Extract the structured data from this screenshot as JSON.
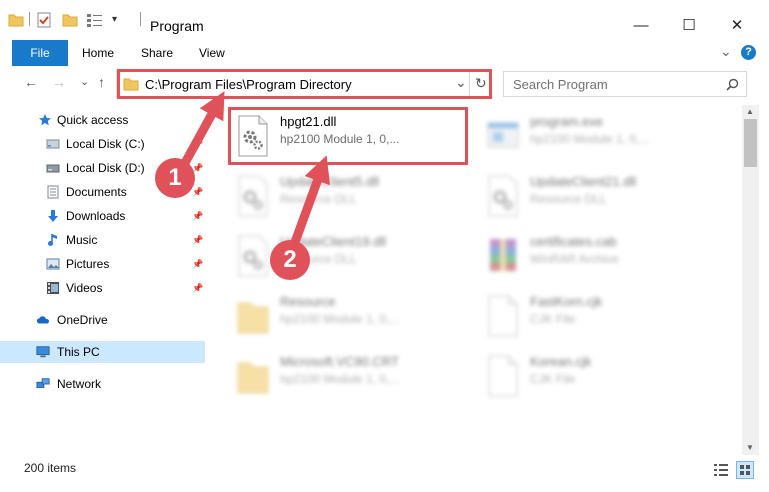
{
  "window": {
    "title": "Program",
    "minimize_glyph": "—",
    "maximize_glyph": "☐",
    "close_glyph": "✕"
  },
  "ribbon": {
    "tabs": [
      {
        "label": "File",
        "active": true
      },
      {
        "label": "Home"
      },
      {
        "label": "Share"
      },
      {
        "label": "View"
      }
    ],
    "help_glyph": "?",
    "expand_glyph": "⌄"
  },
  "nav": {
    "back_glyph": "←",
    "forward_glyph": "→",
    "recent_glyph": "⌄",
    "up_glyph": "↑"
  },
  "address": {
    "path": "C:\\Program Files\\Program Directory",
    "dropdown_glyph": "⌄",
    "refresh_glyph": "↻"
  },
  "search": {
    "placeholder": "Search Program",
    "icon": "search-icon"
  },
  "sidebar": {
    "items": [
      {
        "label": "Quick access",
        "icon": "star-icon",
        "pinned": false
      },
      {
        "label": "Local Disk (C:)",
        "icon": "drive-icon",
        "pinned": true
      },
      {
        "label": "Local Disk (D:)",
        "icon": "drive-icon",
        "pinned": true
      },
      {
        "label": "Documents",
        "icon": "documents-icon",
        "pinned": true
      },
      {
        "label": "Downloads",
        "icon": "download-icon",
        "pinned": true
      },
      {
        "label": "Music",
        "icon": "music-icon",
        "pinned": true
      },
      {
        "label": "Pictures",
        "icon": "pictures-icon",
        "pinned": true
      },
      {
        "label": "Videos",
        "icon": "videos-icon",
        "pinned": true
      },
      {
        "label": "OneDrive",
        "icon": "cloud-icon",
        "pinned": false
      },
      {
        "label": "This PC",
        "icon": "computer-icon",
        "pinned": false,
        "selected": true
      },
      {
        "label": "Network",
        "icon": "network-icon",
        "pinned": false
      }
    ],
    "pin_glyph": "📌"
  },
  "files": [
    {
      "name": "hpgt21.dll",
      "desc": "hp2100 Module 1, 0,...",
      "icon": "dll-gear-icon",
      "highlighted": true
    },
    {
      "name": "program.exe",
      "desc": "hp2100 Module 1, 0,...",
      "icon": "exe-icon"
    },
    {
      "name": "UpdateClient5.dll",
      "desc": "Resource DLL",
      "icon": "dll-gear-icon"
    },
    {
      "name": "UpdateClient21.dll",
      "desc": "Resource DLL",
      "icon": "dll-gear-icon"
    },
    {
      "name": "UpdateClient19.dll",
      "desc": "Resource DLL",
      "icon": "dll-gear-icon"
    },
    {
      "name": "certificates.cab",
      "desc": "WinRAR Archive",
      "icon": "winrar-icon"
    },
    {
      "name": "Resource",
      "desc": "hp2100 Module 1, 0,...",
      "icon": "folder-icon"
    },
    {
      "name": "FastKorn.cjk",
      "desc": "CJK File",
      "icon": "blank-file-icon"
    },
    {
      "name": "Microsoft.VC90.CRT",
      "desc": "hp2100 Module 1, 0,...",
      "icon": "folder-icon"
    },
    {
      "name": "Korean.cjk",
      "desc": "CJK File",
      "icon": "blank-file-icon"
    }
  ],
  "status": {
    "item_count": "200 items"
  },
  "annotations": {
    "step1": "1",
    "step2": "2"
  },
  "colors": {
    "accent": "#1979ca",
    "annotation_red": "#e0525a",
    "selection": "#cce8ff"
  }
}
